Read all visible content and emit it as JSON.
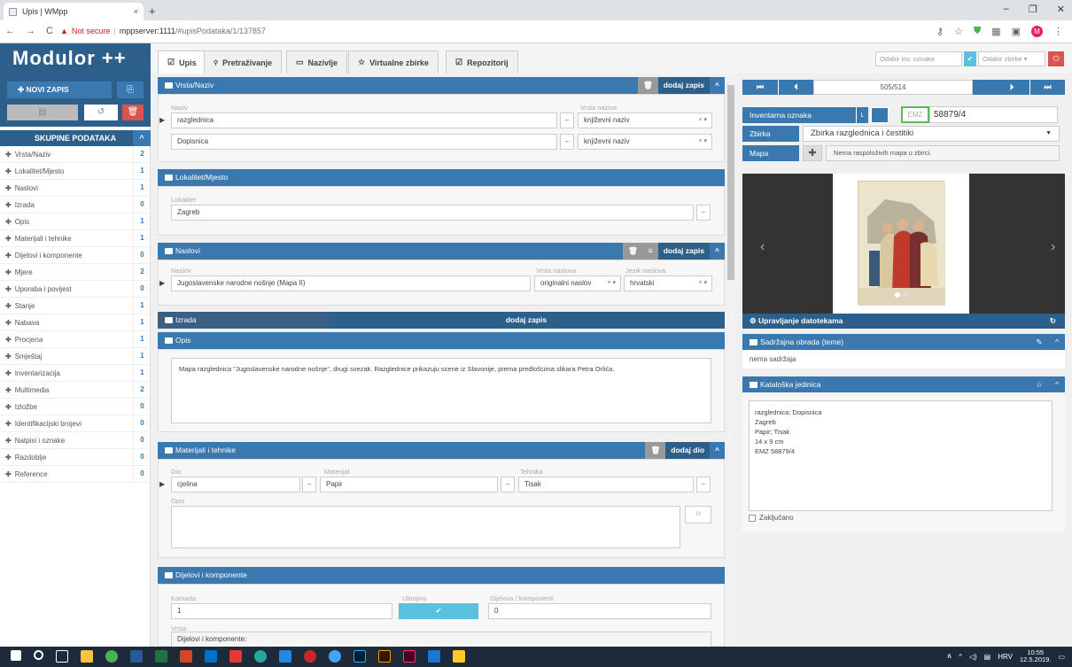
{
  "browser": {
    "tab_title": "Upis | WMpp",
    "tab_close": "×",
    "new_tab": "+",
    "win_min": "–",
    "win_max": "❐",
    "win_close": "✕",
    "back": "←",
    "forward": "→",
    "reload": "C",
    "not_secure": "Not secure",
    "url_host": "mppserver:1111",
    "url_path": "/#upisPodataka/1/137857",
    "avatar": "M"
  },
  "app": {
    "logo": "Modulor ++",
    "tabs": [
      {
        "icon": "☑",
        "label": "Upis"
      },
      {
        "icon": "🔍",
        "label": "Pretraživanje"
      },
      {
        "icon": "▭",
        "label": "Nazivlje"
      },
      {
        "icon": "☆",
        "label": "Virtualne zbirke"
      },
      {
        "icon": "☑",
        "label": "Repozitorij"
      }
    ],
    "search_inv_placeholder": "Odabir inv. oznake",
    "search_zbirke_placeholder": "Odabir zbirke"
  },
  "sidebar": {
    "new_record": "✚ NOVI ZAPIS",
    "groups_title": "SKUPINE PODATAKA",
    "items": [
      {
        "label": "Vrsta/Naziv",
        "count": "2"
      },
      {
        "label": "Lokalitet/Mjesto",
        "count": "1"
      },
      {
        "label": "Naslovi",
        "count": "1"
      },
      {
        "label": "Izrada",
        "count": "0"
      },
      {
        "label": "Opis",
        "count": "1"
      },
      {
        "label": "Materijali i tehnike",
        "count": "1"
      },
      {
        "label": "Dijelovi i komponente",
        "count": "0"
      },
      {
        "label": "Mjere",
        "count": "2"
      },
      {
        "label": "Uporaba i povijest",
        "count": "0"
      },
      {
        "label": "Stanje",
        "count": "1"
      },
      {
        "label": "Nabava",
        "count": "1"
      },
      {
        "label": "Procjena",
        "count": "1"
      },
      {
        "label": "Smještaj",
        "count": "1"
      },
      {
        "label": "Inventarizacija",
        "count": "1"
      },
      {
        "label": "Multimedia",
        "count": "2"
      },
      {
        "label": "Izložbe",
        "count": "0"
      },
      {
        "label": "Identifikacijski brojevi",
        "count": "0"
      },
      {
        "label": "Natpisi i oznake",
        "count": "0"
      },
      {
        "label": "Razdoblje",
        "count": "0"
      },
      {
        "label": "Reference",
        "count": "0"
      }
    ]
  },
  "vrsta": {
    "title": "Vrsta/Naziv",
    "add": "dodaj zapis",
    "naziv_label": "Naziv",
    "vrsta_label": "Vrsta naziva",
    "rows": [
      {
        "naziv": "razglednica",
        "vrsta": "književni naziv"
      },
      {
        "naziv": "Dopisnica",
        "vrsta": "književni naziv"
      }
    ]
  },
  "lokalitet": {
    "title": "Lokalitet/Mjesto",
    "label": "Lokalitet",
    "value": "Zagreb"
  },
  "naslovi": {
    "title": "Naslovi",
    "add": "dodaj zapis",
    "naslov_label": "Naslov",
    "vrsta_label": "Vrsta naslova",
    "jezik_label": "Jezik naslova",
    "naslov": "Jugoslavenske narodne nošnje (Mapa II)",
    "vrsta": "originalni naslov",
    "jezik": "hrvatski"
  },
  "izrada": {
    "title": "Izrada",
    "add": "dodaj zapis"
  },
  "opis": {
    "title": "Opis",
    "text": "Mapa razglednica \"Jugoslavenske narodne nošnje\", drugi svezak. Razglednice prikazuju scene iz Slavonije, prema predlošcima slikara Petra Orlića."
  },
  "materijali": {
    "title": "Materijali i tehnike",
    "add": "dodaj dio",
    "dio_label": "Dio",
    "mat_label": "Materijal",
    "teh_label": "Tehnika",
    "opis_label": "Opis",
    "dio": "cjelina",
    "materijal": "Papir",
    "tehnika": "Tisak"
  },
  "dijelovi": {
    "title": "Dijelovi i komponente",
    "komada_label": "Komada",
    "komada": "1",
    "ubrojeno_label": "Ubrojivo",
    "dijelova_label": "Dijelova / komponenti",
    "dijelova": "0",
    "vrsta_label": "Vrsta",
    "vrsta_value": "Dijelovi i komponente:"
  },
  "right": {
    "counter": "505/514",
    "inv_label": "Inventarna oznaka",
    "inv_L": "L",
    "inv_prefix": "EMZ",
    "inv_number": "58879/4",
    "zbirka_label": "Zbirka",
    "zbirka_value": "Zbirka razglednica i čestitiki",
    "mapa_label": "Mapa",
    "mapa_text": "Nema raspoloživih mapa u zbirci.",
    "files_title": "Upravljanje datotekama",
    "sadrzajna_title": "Sadržajna obrada (teme)",
    "sadrzajna_text": "nema sadržaja",
    "katalog_title": "Kataloška jedinica",
    "katalog_lines": [
      "razglednica; Dopisnica",
      "Zagreb",
      "Papir; Tisak",
      "14 x 9 cm",
      "EMZ 58879/4"
    ],
    "zakljucano": "Zaključano"
  },
  "tray": {
    "lang": "HRV",
    "time": "10:55",
    "date": "12.5.2019."
  },
  "colors": {
    "primary": "#3a78b0",
    "dark": "#2d5f8b",
    "danger": "#d9534f",
    "info": "#5bc0de"
  }
}
